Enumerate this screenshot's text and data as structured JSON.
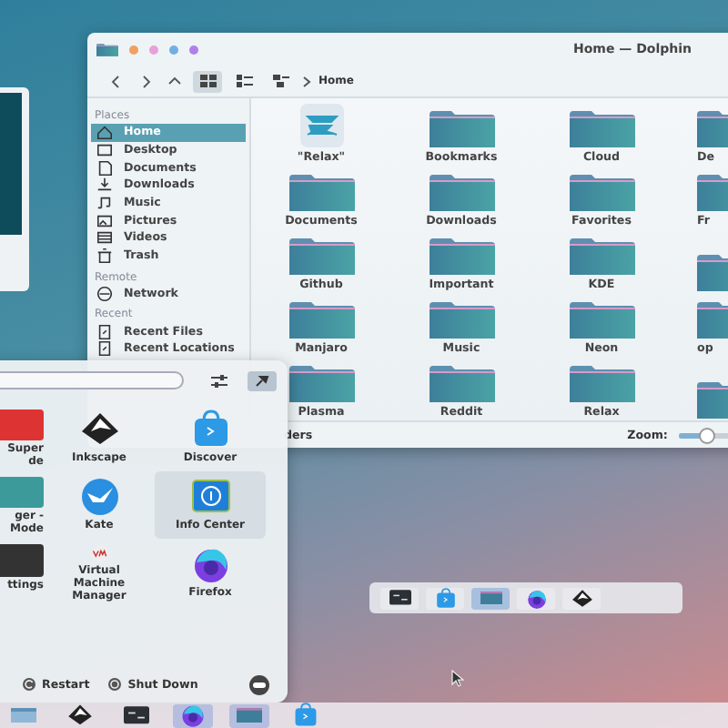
{
  "dolphin": {
    "title": "Home — Dolphin",
    "breadcrumb": "Home",
    "view_modes": [
      {
        "kind": "icons",
        "selected": true
      },
      {
        "kind": "compact",
        "selected": false
      },
      {
        "kind": "details",
        "selected": false
      }
    ],
    "places": [
      {
        "section": "Places",
        "items": [
          {
            "label": "Home",
            "kind": "home",
            "selected": true
          },
          {
            "label": "Desktop",
            "kind": "desktop",
            "selected": false
          },
          {
            "label": "Documents",
            "kind": "documents",
            "selected": false
          },
          {
            "label": "Downloads",
            "kind": "downloads",
            "selected": false
          },
          {
            "label": "Music",
            "kind": "music",
            "selected": false
          },
          {
            "label": "Pictures",
            "kind": "pictures",
            "selected": false
          },
          {
            "label": "Videos",
            "kind": "videos",
            "selected": false
          },
          {
            "label": "Trash",
            "kind": "trash",
            "selected": false
          }
        ]
      },
      {
        "section": "Remote",
        "items": [
          {
            "label": "Network",
            "kind": "network",
            "selected": false
          }
        ]
      },
      {
        "section": "Recent",
        "items": [
          {
            "label": "Recent Files",
            "kind": "recent",
            "selected": false
          },
          {
            "label": "Recent Locations",
            "kind": "recent",
            "selected": false
          }
        ]
      }
    ],
    "files": [
      {
        "label": "\"Relax\"",
        "kind": "logo"
      },
      {
        "label": "Bookmarks",
        "kind": "folder"
      },
      {
        "label": "Cloud",
        "kind": "folder"
      },
      {
        "label": "De",
        "kind": "folder"
      },
      {
        "label": "Documents",
        "kind": "folder"
      },
      {
        "label": "Downloads",
        "kind": "folder"
      },
      {
        "label": "Favorites",
        "kind": "folder"
      },
      {
        "label": "Fr",
        "kind": "folder"
      },
      {
        "label": "Github",
        "kind": "folder"
      },
      {
        "label": "Important",
        "kind": "folder"
      },
      {
        "label": "KDE",
        "kind": "folder"
      },
      {
        "kind": "folder"
      },
      {
        "label": "Manjaro",
        "kind": "folder"
      },
      {
        "label": "Music",
        "kind": "folder"
      },
      {
        "label": "Neon",
        "kind": "folder"
      },
      {
        "label": "op",
        "kind": "folder"
      },
      {
        "label": "Plasma",
        "kind": "folder"
      },
      {
        "label": "Reddit",
        "kind": "folder"
      },
      {
        "label": "Relax",
        "kind": "folder"
      },
      {
        "kind": "folder"
      }
    ],
    "status": "ders",
    "zoom_label": "Zoom:",
    "zoom": {
      "level": 0.25
    }
  },
  "launcher": {
    "apps": [
      {
        "label": "Super\nde",
        "kind": "red",
        "selected": false
      },
      {
        "label": "Inkscape",
        "kind": "inkscape",
        "selected": false
      },
      {
        "label": "Discover",
        "kind": "discover",
        "selected": false
      },
      {
        "label": "ger -\nMode",
        "kind": "teal",
        "selected": false
      },
      {
        "label": "Kate",
        "kind": "kate",
        "selected": false
      },
      {
        "label": "Info Center",
        "kind": "info",
        "selected": true
      },
      {
        "label": "ttings",
        "kind": "dark",
        "selected": false
      },
      {
        "label": "Virtual Machine Manager",
        "kind": "vm",
        "selected": false
      },
      {
        "label": "Firefox",
        "kind": "firefox",
        "selected": false
      }
    ],
    "actions": [
      {
        "label": "Restart",
        "kind": "restart"
      },
      {
        "label": "Shut Down",
        "kind": "shutdown"
      }
    ]
  },
  "task_switcher": [
    {
      "kind": "terminal",
      "selected": false
    },
    {
      "kind": "discover",
      "selected": false
    },
    {
      "kind": "folder",
      "selected": true
    },
    {
      "kind": "firefox",
      "selected": false
    },
    {
      "kind": "inkscape",
      "selected": false
    }
  ],
  "taskbar": [
    {
      "kind": "files",
      "selected": false
    },
    {
      "kind": "inkscape",
      "selected": false
    },
    {
      "kind": "terminal",
      "selected": false
    },
    {
      "kind": "firefox",
      "selected": true
    },
    {
      "kind": "folder",
      "selected": true
    },
    {
      "kind": "discover",
      "selected": false
    }
  ]
}
